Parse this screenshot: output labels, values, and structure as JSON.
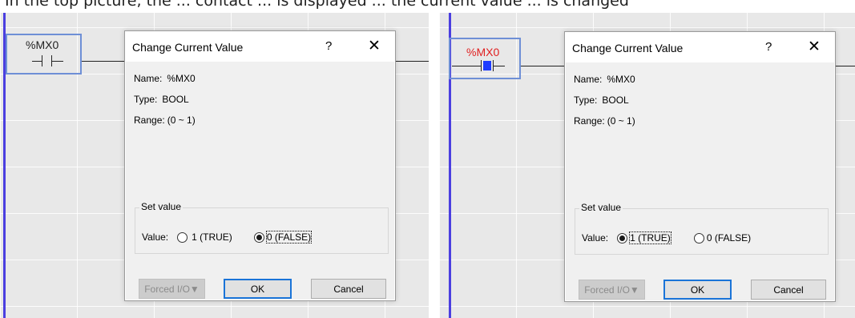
{
  "partial_caption": "In the top picture, the ... contact ... is displayed ... the current value ... is changed",
  "left": {
    "contact_label": "%MX0",
    "dialog": {
      "title": "Change Current Value",
      "help": "?",
      "close": "✕",
      "name_label": "Name:",
      "name_value": "%MX0",
      "type_label": "Type:",
      "type_value": "BOOL",
      "range_label": "Range:",
      "range_value": "(0 ~ 1)",
      "group_title": "Set value",
      "value_label": "Value:",
      "option_true": "1 (TRUE)",
      "option_false": "0 (FALSE)",
      "selected": "0 (FALSE)",
      "forced_io": "Forced I/O▼",
      "ok": "OK",
      "cancel": "Cancel"
    }
  },
  "right": {
    "contact_label": "%MX0",
    "contact_state": "TRUE",
    "dialog": {
      "title": "Change Current Value",
      "help": "?",
      "close": "✕",
      "name_label": "Name:",
      "name_value": "%MX0",
      "type_label": "Type:",
      "type_value": "BOOL",
      "range_label": "Range:",
      "range_value": "(0 ~ 1)",
      "group_title": "Set value",
      "value_label": "Value:",
      "option_true": "1 (TRUE)",
      "option_false": "0 (FALSE)",
      "selected": "1 (TRUE)",
      "forced_io": "Forced I/O▼",
      "ok": "OK",
      "cancel": "Cancel"
    }
  },
  "colors": {
    "rail": "#4b3fe0",
    "active_label": "#e02020",
    "active_contact": "#1e3cff",
    "selection_box": "#6e8fd6",
    "default_button": "#1a74d8"
  }
}
